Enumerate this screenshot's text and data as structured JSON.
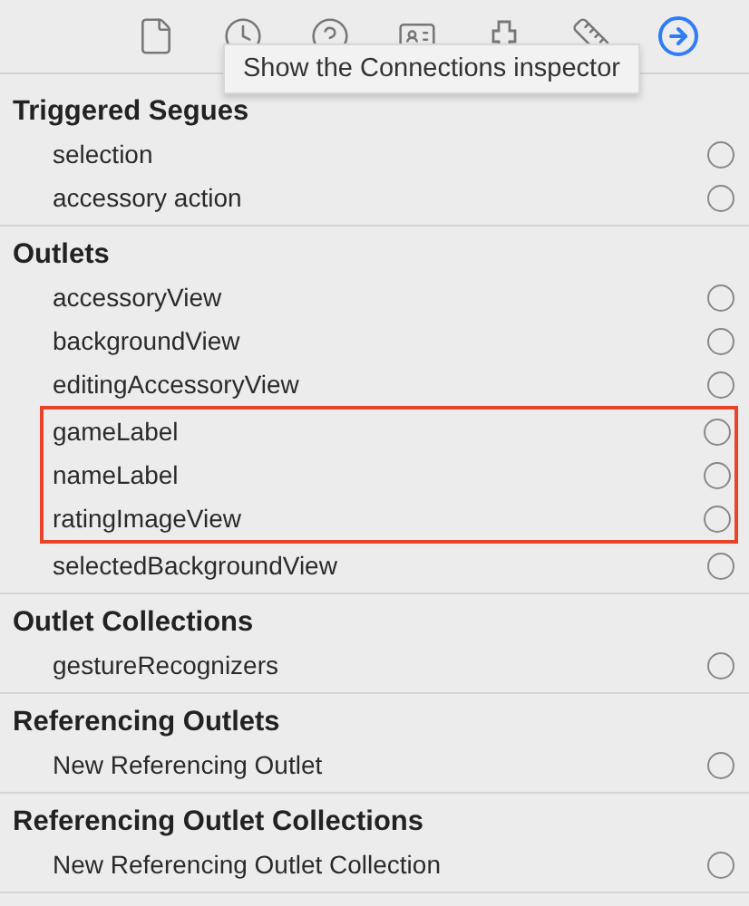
{
  "toolbar": {
    "tabs": [
      {
        "kind": "file",
        "selected": false
      },
      {
        "kind": "history",
        "selected": false
      },
      {
        "kind": "help",
        "selected": false
      },
      {
        "kind": "identity",
        "selected": false
      },
      {
        "kind": "attributes",
        "selected": false
      },
      {
        "kind": "size",
        "selected": false
      },
      {
        "kind": "connections",
        "selected": true
      }
    ]
  },
  "tooltip": {
    "text": "Show the Connections inspector"
  },
  "sections": [
    {
      "title": "Triggered Segues",
      "items": [
        {
          "label": "selection",
          "highlighted": false
        },
        {
          "label": "accessory action",
          "highlighted": false
        }
      ]
    },
    {
      "title": "Outlets",
      "items": [
        {
          "label": "accessoryView",
          "highlighted": false
        },
        {
          "label": "backgroundView",
          "highlighted": false
        },
        {
          "label": "editingAccessoryView",
          "highlighted": false
        },
        {
          "label": "gameLabel",
          "highlighted": true
        },
        {
          "label": "nameLabel",
          "highlighted": true
        },
        {
          "label": "ratingImageView",
          "highlighted": true
        },
        {
          "label": "selectedBackgroundView",
          "highlighted": false
        }
      ]
    },
    {
      "title": "Outlet Collections",
      "items": [
        {
          "label": "gestureRecognizers",
          "highlighted": false
        }
      ]
    },
    {
      "title": "Referencing Outlets",
      "items": [
        {
          "label": "New Referencing Outlet",
          "highlighted": false
        }
      ]
    },
    {
      "title": "Referencing Outlet Collections",
      "items": [
        {
          "label": "New Referencing Outlet Collection",
          "highlighted": false
        }
      ]
    }
  ]
}
